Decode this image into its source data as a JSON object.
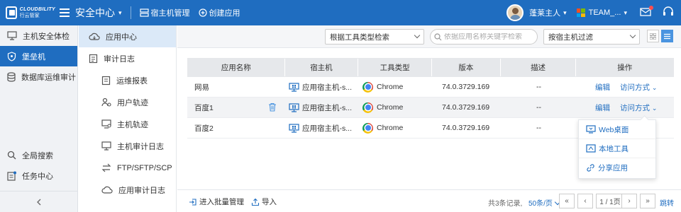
{
  "header": {
    "logo_en": "CLOUDBILITY",
    "logo_cn": "行云管家",
    "app_title": "安全中心",
    "host_manage": "宿主机管理",
    "create_app": "创建应用",
    "user_name": "蓬莱主人",
    "team_name": "TEAM_..."
  },
  "sidebar": {
    "items": [
      {
        "label": "主机安全体检",
        "icon": "screen-check-icon"
      },
      {
        "label": "堡垒机",
        "icon": "shield-icon"
      },
      {
        "label": "数据库运维审计",
        "icon": "database-icon"
      }
    ],
    "bottom": [
      {
        "label": "全局搜索",
        "icon": "search-icon"
      },
      {
        "label": "任务中心",
        "icon": "task-icon"
      }
    ]
  },
  "submenu": {
    "items": [
      {
        "label": "应用中心"
      },
      {
        "label": "审计日志"
      },
      {
        "label": "运维报表"
      },
      {
        "label": "用户轨迹"
      },
      {
        "label": "主机轨迹"
      },
      {
        "label": "主机审计日志"
      },
      {
        "label": "FTP/SFTP/SCP"
      },
      {
        "label": "应用审计日志"
      }
    ]
  },
  "toolbar": {
    "tool_filter": "根据工具类型检索",
    "search_placeholder": "依据应用名称关键字检索",
    "host_filter": "按宿主机过滤"
  },
  "table": {
    "headers": [
      "应用名称",
      "宿主机",
      "工具类型",
      "版本",
      "描述",
      "操作"
    ],
    "rows": [
      {
        "name": "网易",
        "host": "应用宿主机-s...",
        "tool": "Chrome",
        "version": "74.0.3729.169",
        "desc": "--"
      },
      {
        "name": "百度1",
        "host": "应用宿主机-s...",
        "tool": "Chrome",
        "version": "74.0.3729.169",
        "desc": "--"
      },
      {
        "name": "百度2",
        "host": "应用宿主机-s...",
        "tool": "Chrome",
        "version": "74.0.3729.169",
        "desc": "--"
      }
    ],
    "edit_label": "编辑",
    "access_label": "访问方式"
  },
  "dropdown": {
    "items": [
      "Web桌面",
      "本地工具",
      "分享应用"
    ]
  },
  "footer": {
    "batch_manage": "进入批量管理",
    "import": "导入",
    "records": "共3条记录,",
    "page_size": "50条/页",
    "page": "1 / 1页",
    "jump": "跳转"
  },
  "colors": {
    "primary": "#1f6dc0",
    "sidebar_active": "#1f6dc0",
    "submenu_active": "#dbe9f8"
  }
}
